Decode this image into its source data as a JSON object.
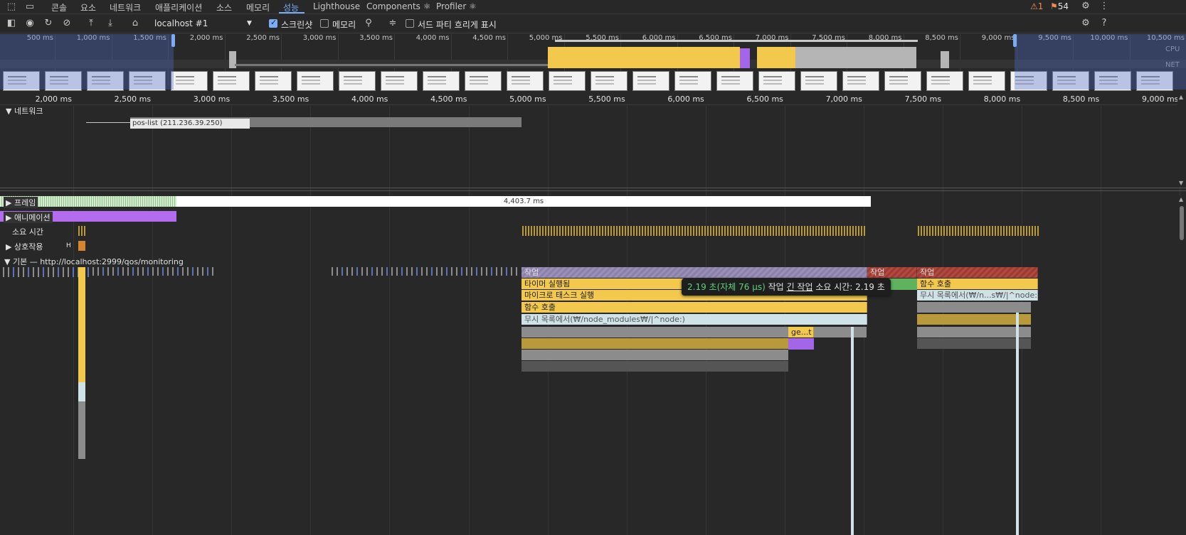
{
  "tabs": [
    {
      "label": "콘솔"
    },
    {
      "label": "요소"
    },
    {
      "label": "네트워크"
    },
    {
      "label": "애플리케이션"
    },
    {
      "label": "소스"
    },
    {
      "label": "메모리"
    },
    {
      "label": "성능"
    },
    {
      "label": "Lighthouse"
    },
    {
      "label": "Components ⚛"
    },
    {
      "label": "Profiler ⚛"
    }
  ],
  "status": {
    "warnings": "1",
    "issues": "54"
  },
  "toolbar": {
    "target": "localhost #1",
    "screenshots_label": "스크린샷",
    "screenshots_checked": true,
    "memory_label": "메모리",
    "memory_checked": false,
    "third_party_label": "서드 파티 흐리게 표시",
    "third_party_checked": false
  },
  "overview": {
    "ticks": [
      "500 ms",
      "1,000 ms",
      "1,500 ms",
      "2,000 ms",
      "2,500 ms",
      "3,000 ms",
      "3,500 ms",
      "4,000 ms",
      "4,500 ms",
      "5,000 ms",
      "5,500 ms",
      "6,000 ms",
      "6,500 ms",
      "7,000 ms",
      "7,500 ms",
      "8,000 ms",
      "8,500 ms",
      "9,000 ms",
      "9,500 ms",
      "10,000 ms",
      "10,500 ms"
    ],
    "cpu_label": "CPU",
    "net_label": "NET"
  },
  "ruler": {
    "ticks": [
      "2,000 ms",
      "2,500 ms",
      "3,000 ms",
      "3,500 ms",
      "4,000 ms",
      "4,500 ms",
      "5,000 ms",
      "5,500 ms",
      "6,000 ms",
      "6,500 ms",
      "7,000 ms",
      "7,500 ms",
      "8,000 ms",
      "8,500 ms",
      "9,000 ms"
    ]
  },
  "network": {
    "label": "네트워크",
    "request": "pos-list (211.236.39.250)"
  },
  "tracks": {
    "frames_label": "프레임",
    "frame_duration": "4,403.7 ms",
    "animations_label": "애니메이션",
    "timings_label": "소요 시간",
    "interactions_label": "상호작용",
    "interaction_short": "H",
    "main_label": "기본 — http://localhost:2999/qos/monitoring"
  },
  "flame": {
    "task1": "작업",
    "task2": "작업",
    "task3": "작업",
    "timer": "타이머 실행됨",
    "microtask": "마이크로 태스크 실행",
    "func1": "함수 호출",
    "ignore1": "무시 목록에서(₩/node_modules₩/|^node:)",
    "func2": "함수 호출",
    "ignore2": "무시 목록에서(₩/n...s₩/|^node:)",
    "get": "ge...t"
  },
  "tooltip": {
    "duration": "2.19 초(자체 76 µs)",
    "task_word": "작업",
    "long_task": "긴 작업",
    "rest": "소요 시간: 2.19 초"
  },
  "colors": {
    "accent": "#7cacf8",
    "scripting": "#f2c94c",
    "task": "#8c8c8c",
    "long_task_red": "#c4463a",
    "rendering": "#a366e8",
    "ignored": "#cfe2e8"
  }
}
